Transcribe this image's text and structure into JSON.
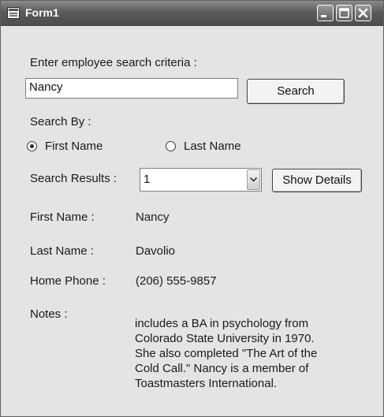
{
  "window": {
    "title": "Form1",
    "icon": "form-app-icon",
    "controls": [
      "minimize-icon",
      "maximize-icon",
      "close-icon"
    ]
  },
  "search": {
    "prompt": "Enter employee search criteria :",
    "value": "Nancy",
    "button_label": "Search"
  },
  "search_by": {
    "label": "Search By :",
    "options": [
      {
        "label": "First Name",
        "checked": true
      },
      {
        "label": "Last Name",
        "checked": false
      }
    ]
  },
  "results": {
    "label": "Search Results :",
    "selected": "1",
    "details_button": "Show Details"
  },
  "details": {
    "first_name_label": "First Name :",
    "first_name": "Nancy",
    "last_name_label": "Last Name :",
    "last_name": "Davolio",
    "phone_label": "Home Phone :",
    "phone": "(206) 555-9857",
    "notes_label": "Notes :",
    "notes": "includes a BA in psychology from\nColorado State University in 1970.\nShe also completed \"The Art of the\nCold Call.\" Nancy is a member of\nToastmasters International."
  }
}
